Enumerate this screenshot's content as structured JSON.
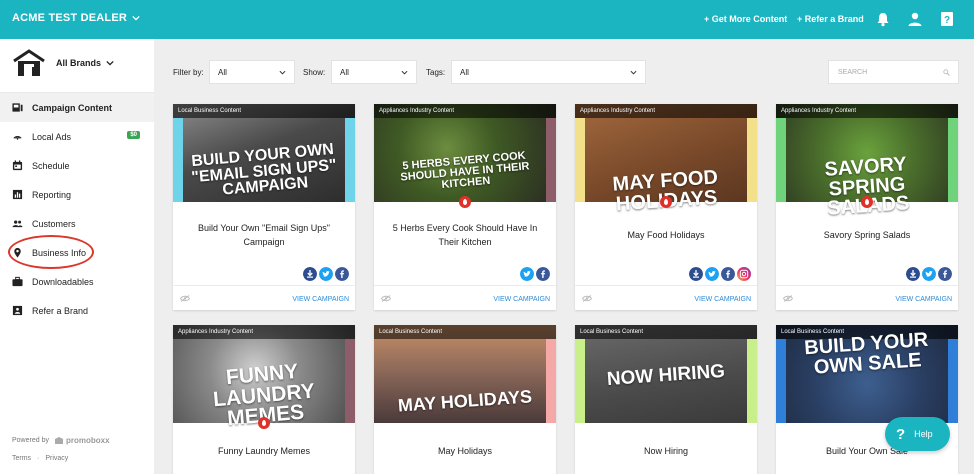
{
  "topbar": {
    "dealer": "ACME TEST DEALER",
    "get_more_content": "+ Get More Content",
    "refer_brand": "+ Refer a Brand"
  },
  "sidebar": {
    "brands_label": "All Brands",
    "items": [
      {
        "label": "Campaign Content",
        "icon": "campaign-content-icon",
        "active": true
      },
      {
        "label": "Local Ads",
        "icon": "local-ads-icon",
        "badge": "$0"
      },
      {
        "label": "Schedule",
        "icon": "calendar-icon"
      },
      {
        "label": "Reporting",
        "icon": "bar-chart-icon"
      },
      {
        "label": "Customers",
        "icon": "people-icon"
      },
      {
        "label": "Business Info",
        "icon": "map-pin-icon"
      },
      {
        "label": "Downloadables",
        "icon": "briefcase-icon"
      },
      {
        "label": "Refer a Brand",
        "icon": "contact-card-icon"
      }
    ],
    "powered_by": "Powered by",
    "powered_brand": "promoboxx",
    "terms": "Terms",
    "privacy": "Privacy",
    "link_separator": "·"
  },
  "filters": {
    "filter_by_label": "Filter by:",
    "filter_by_value": "All",
    "show_label": "Show:",
    "show_value": "All",
    "tags_label": "Tags:",
    "tags_value": "All",
    "search_placeholder": "SEARCH"
  },
  "cards": [
    {
      "category": "Local Business Content",
      "headline": "BUILD YOUR OWN \"EMAIL SIGN UPS\" CAMPAIGN",
      "title": "Build Your Own \"Email Sign Ups\" Campaign",
      "stripe": "#6fd3ea",
      "socials": [
        "download",
        "twitter",
        "facebook"
      ],
      "view": "VIEW CAMPAIGN"
    },
    {
      "category": "Appliances Industry Content",
      "headline": "5 HERBS EVERY COOK SHOULD HAVE IN THEIR KITCHEN",
      "title": "5 Herbs Every Cook Should Have In Their Kitchen",
      "stripe": "",
      "socials": [
        "twitter",
        "facebook"
      ],
      "view": "VIEW CAMPAIGN"
    },
    {
      "category": "Appliances Industry Content",
      "headline": "MAY FOOD HOLIDAYS",
      "title": "May Food Holidays",
      "stripe": "#f3e08a",
      "socials": [
        "download",
        "twitter",
        "facebook",
        "instagram"
      ],
      "view": "VIEW CAMPAIGN"
    },
    {
      "category": "Appliances Industry Content",
      "headline": "SAVORY SPRING SALADS",
      "title": "Savory Spring Salads",
      "stripe": "#6fd37c",
      "socials": [
        "download",
        "twitter",
        "facebook"
      ],
      "view": "VIEW CAMPAIGN"
    },
    {
      "category": "Appliances Industry Content",
      "headline": "FUNNY LAUNDRY MEMES",
      "title": "Funny Laundry Memes",
      "stripe": "",
      "view": ""
    },
    {
      "category": "Local Business Content",
      "headline": "MAY HOLIDAYS",
      "title": "May Holidays",
      "stripe": "#f4a9a8",
      "view": ""
    },
    {
      "category": "Local Business Content",
      "headline": "NOW HIRING",
      "title": "Now Hiring",
      "stripe": "#c9ef8a",
      "view": ""
    },
    {
      "category": "Local Business Content",
      "headline": "BUILD YOUR OWN SALE",
      "title": "Build Your Own Sale",
      "stripe": "#2f7fd9",
      "view": ""
    }
  ],
  "help": {
    "glyph": "?",
    "label": "Help"
  },
  "colors": {
    "accent": "#1bb5c2",
    "link": "#2f8bd8",
    "badge": "#3aa655",
    "ring": "#d9382b"
  }
}
